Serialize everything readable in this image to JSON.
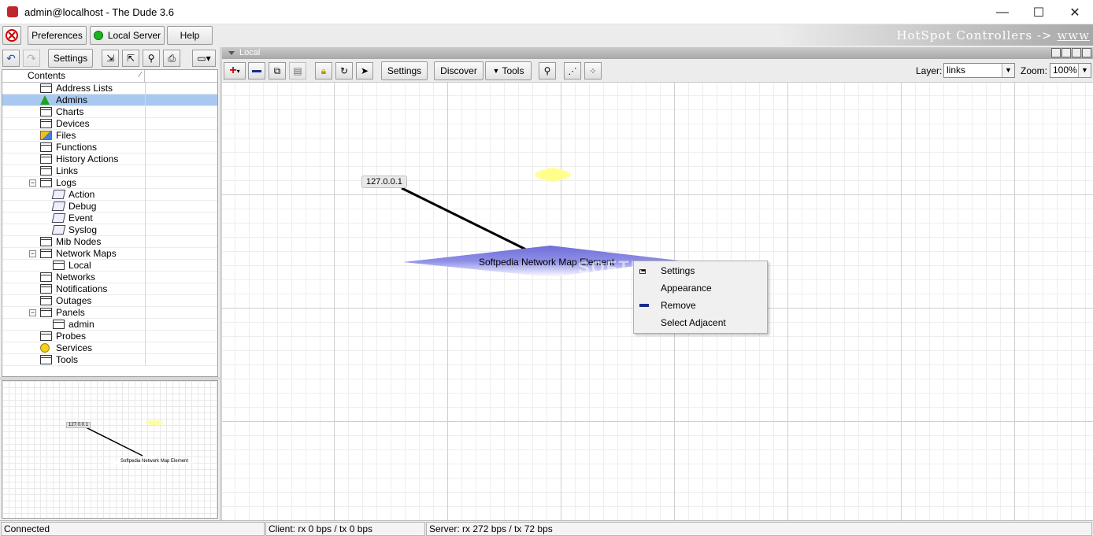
{
  "window": {
    "title": "admin@localhost - The Dude 3.6",
    "minimize": "—",
    "maximize": "☐",
    "close": "✕"
  },
  "menu": {
    "preferences": "Preferences",
    "local_server": "Local Server",
    "help": "Help",
    "banner": "HotSpot Controllers ->",
    "banner_link": "www",
    "connected_color": "#1db31d"
  },
  "left_toolbar": {
    "settings": "Settings"
  },
  "tree": {
    "header": "Contents",
    "items": [
      {
        "label": "Address Lists",
        "icon": "table-icon"
      },
      {
        "label": "Admins",
        "icon": "admin-icon",
        "selected": true
      },
      {
        "label": "Charts",
        "icon": "table-icon"
      },
      {
        "label": "Devices",
        "icon": "table-icon"
      },
      {
        "label": "Files",
        "icon": "files-icon"
      },
      {
        "label": "Functions",
        "icon": "table-icon"
      },
      {
        "label": "History Actions",
        "icon": "table-icon"
      },
      {
        "label": "Links",
        "icon": "table-icon"
      },
      {
        "label": "Logs",
        "icon": "table-icon",
        "expanded": true
      },
      {
        "label": "Action",
        "icon": "log-icon",
        "child": true
      },
      {
        "label": "Debug",
        "icon": "log-icon",
        "child": true
      },
      {
        "label": "Event",
        "icon": "log-icon",
        "child": true
      },
      {
        "label": "Syslog",
        "icon": "log-icon",
        "child": true
      },
      {
        "label": "Mib Nodes",
        "icon": "table-icon"
      },
      {
        "label": "Network Maps",
        "icon": "table-icon",
        "expanded": true
      },
      {
        "label": "Local",
        "icon": "table-icon",
        "child": true
      },
      {
        "label": "Networks",
        "icon": "table-icon"
      },
      {
        "label": "Notifications",
        "icon": "table-icon"
      },
      {
        "label": "Outages",
        "icon": "table-icon"
      },
      {
        "label": "Panels",
        "icon": "table-icon",
        "expanded": true
      },
      {
        "label": "admin",
        "icon": "table-icon",
        "child": true
      },
      {
        "label": "Probes",
        "icon": "table-icon"
      },
      {
        "label": "Services",
        "icon": "gear-icon"
      },
      {
        "label": "Tools",
        "icon": "table-icon"
      }
    ]
  },
  "map": {
    "panel_title": "Local",
    "toolbar": {
      "settings": "Settings",
      "discover": "Discover",
      "tools": "Tools",
      "layer_label": "Layer:",
      "layer_value": "links",
      "zoom_label": "Zoom:",
      "zoom_value": "100%"
    },
    "device": "127.0.0.1",
    "network_element": "Softpedia Network Map Element",
    "watermark": "SOFTPEDIA",
    "context_menu": [
      "Settings",
      "Appearance",
      "Remove",
      "Select Adjacent"
    ]
  },
  "minimap": {
    "device": "127.0.0.1",
    "network_element": "Softpedia Network Map Element"
  },
  "status": {
    "connection": "Connected",
    "client": "Client: rx 0 bps / tx 0 bps",
    "server": "Server: rx 272 bps / tx 72 bps"
  }
}
